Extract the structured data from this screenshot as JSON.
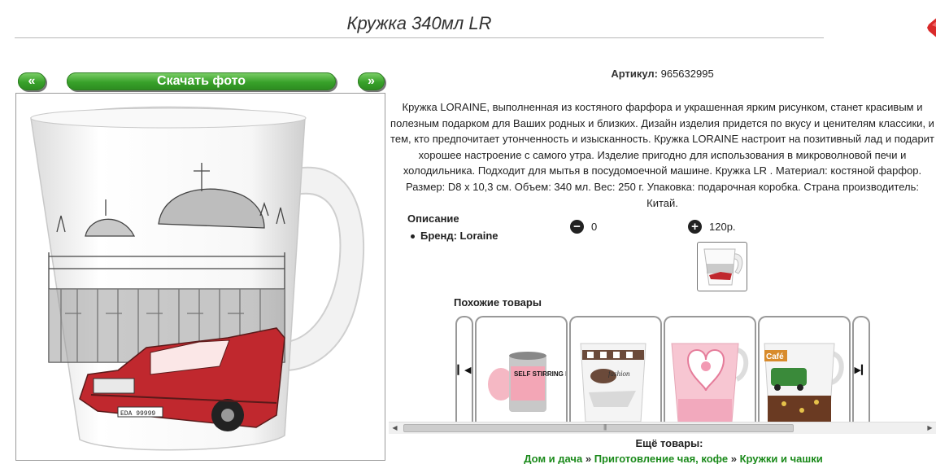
{
  "product": {
    "title": "Кружка 340мл LR",
    "article_label": "Артикул:",
    "article_value": "965632995",
    "description": "Кружка LORAINE, выполненная из костяного фарфора и украшенная ярким рисунком, станет красивым и полезным подарком для Ваших родных и близких. Дизайн изделия придется по вкусу и ценителям классики, и тем, кто предпочитает утонченность и изысканность. Кружка LORAINE настроит на позитивный лад и подарит хорошее настроение с самого утра. Изделие пригодно для использования в микроволновой печи и холодильника. Подходит для мытья в посудомоечной машине. Кружка LR . Материал: костяной фарфор. Размер: D8 x 10,3 см. Объем: 340 мл. Вес: 250 г. Упаковка: подарочная коробка. Страна производитель: Китай.",
    "desc_heading": "Описание",
    "brand": "Бренд: Loraine"
  },
  "photo_nav": {
    "prev": "«",
    "download": "Скачать фото",
    "next": "»"
  },
  "votes": {
    "minus_value": "0",
    "plus_value": "120р."
  },
  "similar": {
    "heading": "Похожие товары",
    "items": [
      {
        "label": "SELF STIRRING MUG"
      },
      {
        "label": "fashion"
      },
      {
        "label": ""
      },
      {
        "label": "Café"
      }
    ]
  },
  "more": {
    "heading": "Ещё товары:",
    "crumbs": [
      "Дом и дача",
      "Приготовление чая, кофе",
      "Кружки и чашки"
    ],
    "separator": "»"
  },
  "colors": {
    "green_button": "#38a12a",
    "link_green": "#1b8a1b",
    "accent_red": "#c0282e"
  }
}
